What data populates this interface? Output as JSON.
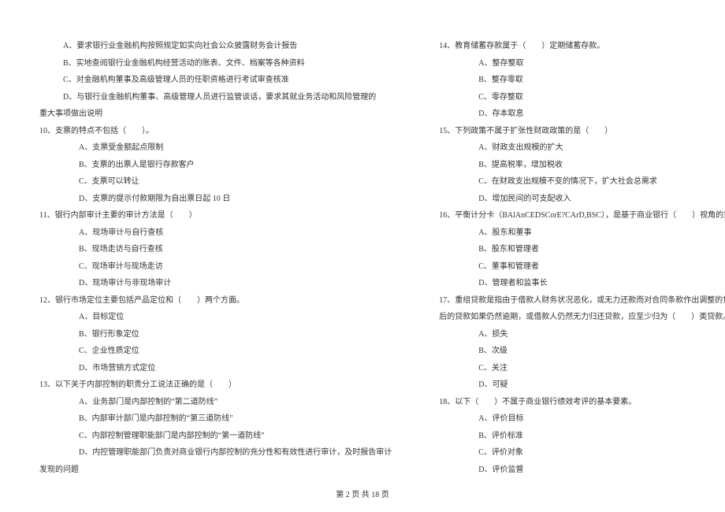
{
  "left": {
    "l1": "A、要求银行业金融机构按照规定如实向社会公众披露财务会计报告",
    "l2": "B、实地查阅银行业金融机构经营活动的账表、文件、档案等各种资料",
    "l3": "C、对金融机构董事及高级管理人员的任职资格进行考试审查核准",
    "l4": "D、与银行业金融机构董事、高级管理人员进行监管谈话，要求其就业务活动和风险管理的",
    "l5": "重大事项做出说明",
    "q10": "10、支票的特点不包括（　　）。",
    "q10a": "A、支票受金额起点限制",
    "q10b": "B、支票的出票人是银行存款客户",
    "q10c": "C、支票可以转让",
    "q10d": "D、支票的提示付款期限为自出票日起 10 日",
    "q11": "11、银行内部审计主要的审计方法是（　　）",
    "q11a": "A、现场审计与自行查核",
    "q11b": "B、现场走访与自行查核",
    "q11c": "C、现场审计与现场走访",
    "q11d": "D、现场审计与非现场审计",
    "q12": "12、银行市场定位主要包括产品定位和（　　）两个方面。",
    "q12a": "A、目标定位",
    "q12b": "B、银行形象定位",
    "q12c": "C、企业性质定位",
    "q12d": "D、市场营销方式定位",
    "q13": "13、以下关于内部控制的职责分工说法正确的是（　　）",
    "q13a": "A、业务部门是内部控制的“第二道防线”",
    "q13b": "B、内部审计部门是内部控制的“第三道防线”",
    "q13c": "C、内部控制管理职能部门是内部控制的“第一道防线”",
    "q13d": "D、内控管理职能部门负责对商业银行内部控制的充分性和有效性进行审计，及时报告审计",
    "q13e": "发现的问题"
  },
  "right": {
    "q14": "14、教育储蓄存款属于（　　）定期储蓄存款。",
    "q14a": "A、整存整取",
    "q14b": "B、整存零取",
    "q14c": "C、零存整取",
    "q14d": "D、存本取息",
    "q15": "15、下列政策不属于扩张性财政政策的是（　　）",
    "q15a": "A、财政支出规模的扩大",
    "q15b": "B、提高税率，增加税收",
    "q15c": "C、在财政支出规模不变的情况下，扩大社会总需求",
    "q15d": "D、增加民间的可支配收入",
    "q16": "16、平衡计分卡（BAlAnCEDSCorE?CArD,BSC），是基于商业银行（　　）视角的重要评价工具。",
    "q16a": "A、股东和董事",
    "q16b": "B、股东和管理者",
    "q16c": "C、董事和管理者",
    "q16d": "D、管理者和监事长",
    "q17": "17、重组贷款是指由于借款人财务状况恶化，或无力还款而对合同条款作出调整的贷款，重组",
    "q17x": "后的贷款如果仍然逾期，或借款人仍然无力归还贷款，应至少归为（　　）类贷款。",
    "q17a": "A、损失",
    "q17b": "B、次级",
    "q17c": "C、关注",
    "q17d": "D、可疑",
    "q18": "18、以下（　　）不属于商业银行绩效考评的基本要素。",
    "q18a": "A、评价目标",
    "q18b": "B、评价标准",
    "q18c": "C、评价对象",
    "q18d": "D、评价监督"
  },
  "footer": "第 2 页 共 18 页"
}
